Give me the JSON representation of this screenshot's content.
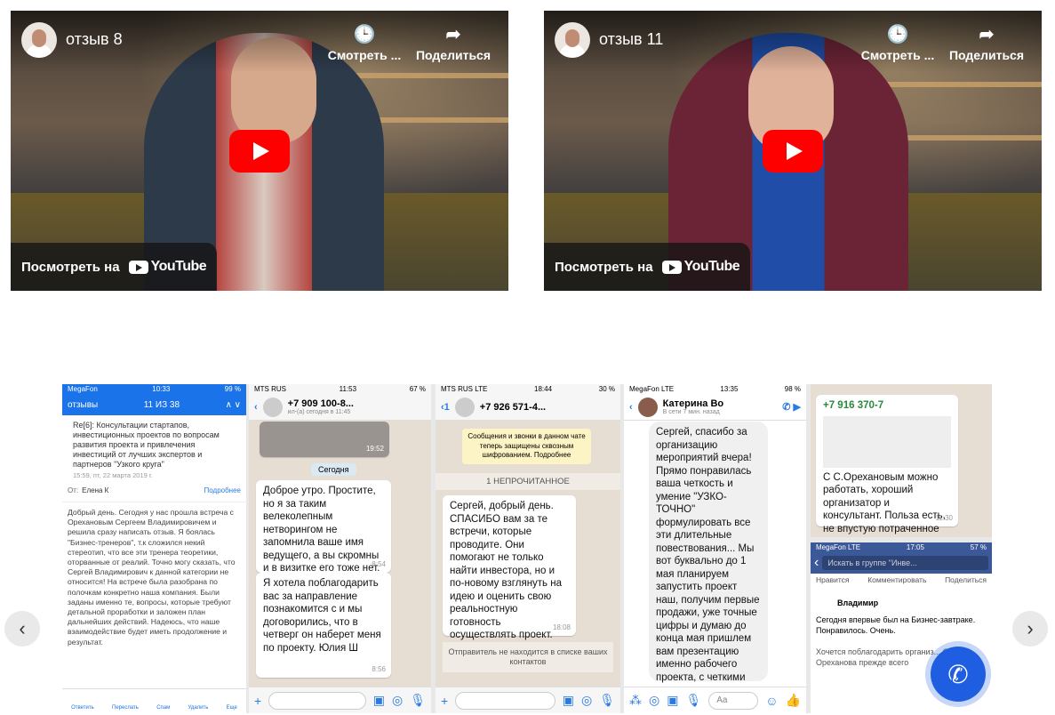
{
  "videos": [
    {
      "title": "отзыв 8",
      "watch_later": "Смотреть ...",
      "share": "Поделиться",
      "watch_on": "Посмотреть на",
      "youtube": "YouTube"
    },
    {
      "title": "отзыв 11",
      "watch_later": "Смотреть ...",
      "share": "Поделиться",
      "watch_on": "Посмотреть на",
      "youtube": "YouTube"
    }
  ],
  "icons": {
    "clock": "clock-icon",
    "share": "share-icon",
    "play": "play-icon",
    "prev": "chevron-left-icon",
    "next": "chevron-right-icon",
    "phone": "phone-icon"
  },
  "screens": {
    "mail": {
      "carrier": "MegaFon",
      "time": "10:33",
      "battery": "99 %",
      "back": "отзывы",
      "counter": "11 ИЗ 38",
      "subject": "Re[6]: Консультации стартапов, инвестиционных проектов по вопросам развития проекта и привлечения инвестиций от лучших экспертов и партнеров \"Узкого круга\"",
      "date": "15:59, пт, 22 марта 2019 г.",
      "from_label": "От:",
      "from": "Елена К",
      "more": "Подробнее",
      "body": "Добрый день. Сегодня у нас прошла встреча с Орехановым Сергеем Владимировичем и решила сразу написать отзыв. Я боялась \"Бизнес-тренеров\", т.к сложился некий стереотип, что все эти тренера теоретики, оторванные от реалий. Точно могу сказать, что Сергей Владимирович к данной категории не относится! На встрече была разобрана по полочкам конкретно наша компания. Были заданы именно те, вопросы, которые требуют детальной проработки и заложен план дальнейших действий. Надеюсь, что наше взаимодействие будет иметь продолжение и результат.",
      "actions": [
        "Ответить",
        "Переслать",
        "Спам",
        "Удалить",
        "Еще"
      ]
    },
    "wa1": {
      "carrier": "MTS RUS",
      "time": "11:53",
      "battery": "67 %",
      "phone": "+7 909 100-8...",
      "status": "ил-(а) сегодня в 11:45",
      "t1": "19:52",
      "day": "Сегодня",
      "m1": "Доброе утро. Простите, но я за таким велеколепным нетворингом не запомнила ваше имя ведущего, а вы скромны и в визитке его тоже нет.",
      "m1t": "8:54",
      "m2": "Я хотела поблагодарить вас за направление познакомится с                   и мы договорились, что в четверг он наберет меня по проекту. Юлия Ш",
      "m2t": "8:56"
    },
    "wa2": {
      "carrier": "MTS RUS",
      "net": "LTE",
      "time": "18:44",
      "battery": "30 %",
      "back": "1",
      "phone": "+7 926 571-4...",
      "secure": "Сообщения и звонки в данном чате теперь защищены сквозным шифрованием. Подробнее",
      "unread": "1 НЕПРОЧИТАННОЕ",
      "m1": "Сергей, добрый день. СПАСИБО вам за те встречи, которые проводите. Они помогают не только найти инвестора, но и по-новому взглянуть на идею и оценить свою реальностную готовность осуществлять проект.",
      "m1t": "18:08",
      "notice": "Отправитель не находится в списке ваших контактов"
    },
    "fb": {
      "carrier": "MegaFon",
      "net": "LTE",
      "time": "13:35",
      "battery": "98 %",
      "name": "Катерина Во",
      "status": "В сети 7 мин. назад",
      "m1": "Сергей, спасибо за организацию мероприятий вчера! Прямо понравилась ваша четкость и умение \"УЗКО-ТОЧНО\" формулировать все эти длительные повествования... Мы вот буквально до 1 мая планируем запустить проект наш, получим первые продажи, уже точные цифры и думаю до конца мая пришлем вам презентацию именно рабочего проекта, с четкими запросами на предмет инвестиций. Сейчас, за неделю до нашего",
      "input": "Aa"
    },
    "misc": {
      "phone": "+7 916 370-7",
      "m1": "С С.Орехановым можно работать, хороший организатор и консультант. Польза есть, не впустую потраченное время.",
      "m1t": "11:30",
      "carrier": "MegaFon",
      "net": "LTE",
      "time": "17:05",
      "battery": "57 %",
      "search": "Искать в группе \"Инве...",
      "links": [
        "Нравится",
        "Комментировать",
        "Поделиться"
      ],
      "author": "Владимир",
      "p1": "Сегодня впервые был на Бизнес-завтраке. Понравилось. Очень.",
      "p2": "Хочется поблагодарить организ... Сергея Ореханова прежде всего"
    }
  }
}
